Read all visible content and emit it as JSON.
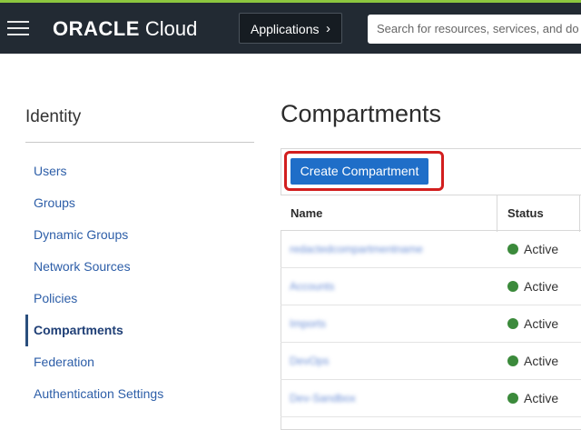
{
  "colors": {
    "accent_line": "#8cc63f",
    "header_bg": "#222a33",
    "primary_button": "#1f6ec8",
    "highlight_box": "#d21e1e",
    "status_active": "#3b8a3b",
    "link": "#2d5ea8"
  },
  "header": {
    "menu_icon": "hamburger-menu-icon",
    "brand_strong": "ORACLE",
    "brand_light": "Cloud",
    "apps_label": "Applications",
    "apps_chevron": "›",
    "search_placeholder": "Search for resources, services, and do"
  },
  "sidebar": {
    "title": "Identity",
    "items": [
      {
        "label": "Users"
      },
      {
        "label": "Groups"
      },
      {
        "label": "Dynamic Groups"
      },
      {
        "label": "Network Sources"
      },
      {
        "label": "Policies"
      },
      {
        "label": "Compartments",
        "active": true
      },
      {
        "label": "Federation"
      },
      {
        "label": "Authentication Settings"
      }
    ]
  },
  "main": {
    "title": "Compartments",
    "create_button": "Create Compartment",
    "table": {
      "headers": {
        "name": "Name",
        "status": "Status"
      },
      "rows": [
        {
          "name": "redactedcompartmentname",
          "status": "Active"
        },
        {
          "name": "Accounts",
          "status": "Active"
        },
        {
          "name": "Imports",
          "status": "Active"
        },
        {
          "name": "DevOps",
          "status": "Active"
        },
        {
          "name": "Dev-Sandbox",
          "status": "Active"
        }
      ]
    }
  }
}
